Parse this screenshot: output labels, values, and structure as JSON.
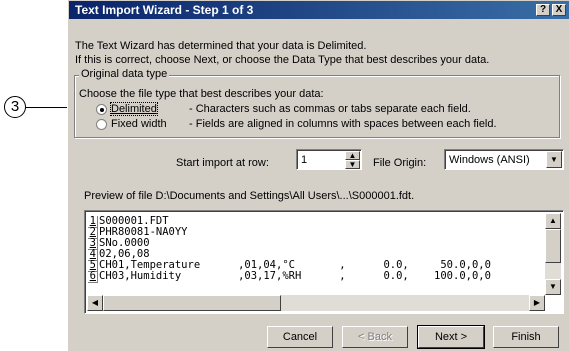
{
  "callout": {
    "number": "3"
  },
  "dialog": {
    "title": "Text Import Wizard - Step 1 of 3",
    "help_label": "?",
    "close_label": "X",
    "intro_line1": "The Text Wizard has determined that your data is Delimited.",
    "intro_line2": "If this is correct, choose Next, or choose the Data Type that best describes your data.",
    "group_label": "Original data type",
    "choose_label": "Choose the file type that best describes your data:",
    "options": [
      {
        "label": "Delimited",
        "description": "- Characters such as commas or tabs separate each field.",
        "selected": true
      },
      {
        "label": "Fixed width",
        "description": "- Fields are aligned in columns with spaces between each field.",
        "selected": false
      }
    ],
    "start_row_label": "Start import at row:",
    "start_row_value": "1",
    "origin_label": "File Origin:",
    "origin_value": "Windows (ANSI)",
    "preview_label": "Preview of file D:\\Documents and Settings\\All Users\\...\\S000001.fdt.",
    "preview_rows": [
      {
        "num": "1",
        "text": "S000001.FDT"
      },
      {
        "num": "2",
        "text": "PHR80081-NA0YY"
      },
      {
        "num": "3",
        "text": "SNo.0000"
      },
      {
        "num": "4",
        "text": "02,06,08"
      },
      {
        "num": "5",
        "text": "CH01,Temperature      ,01,04,°C       ,      0.0,     50.0,0,0"
      },
      {
        "num": "6",
        "text": "CH03,Humidity         ,03,17,%RH      ,      0.0,    100.0,0,0"
      }
    ],
    "buttons": {
      "cancel": "Cancel",
      "back": "< Back",
      "next": "Next >",
      "finish": "Finish"
    }
  }
}
